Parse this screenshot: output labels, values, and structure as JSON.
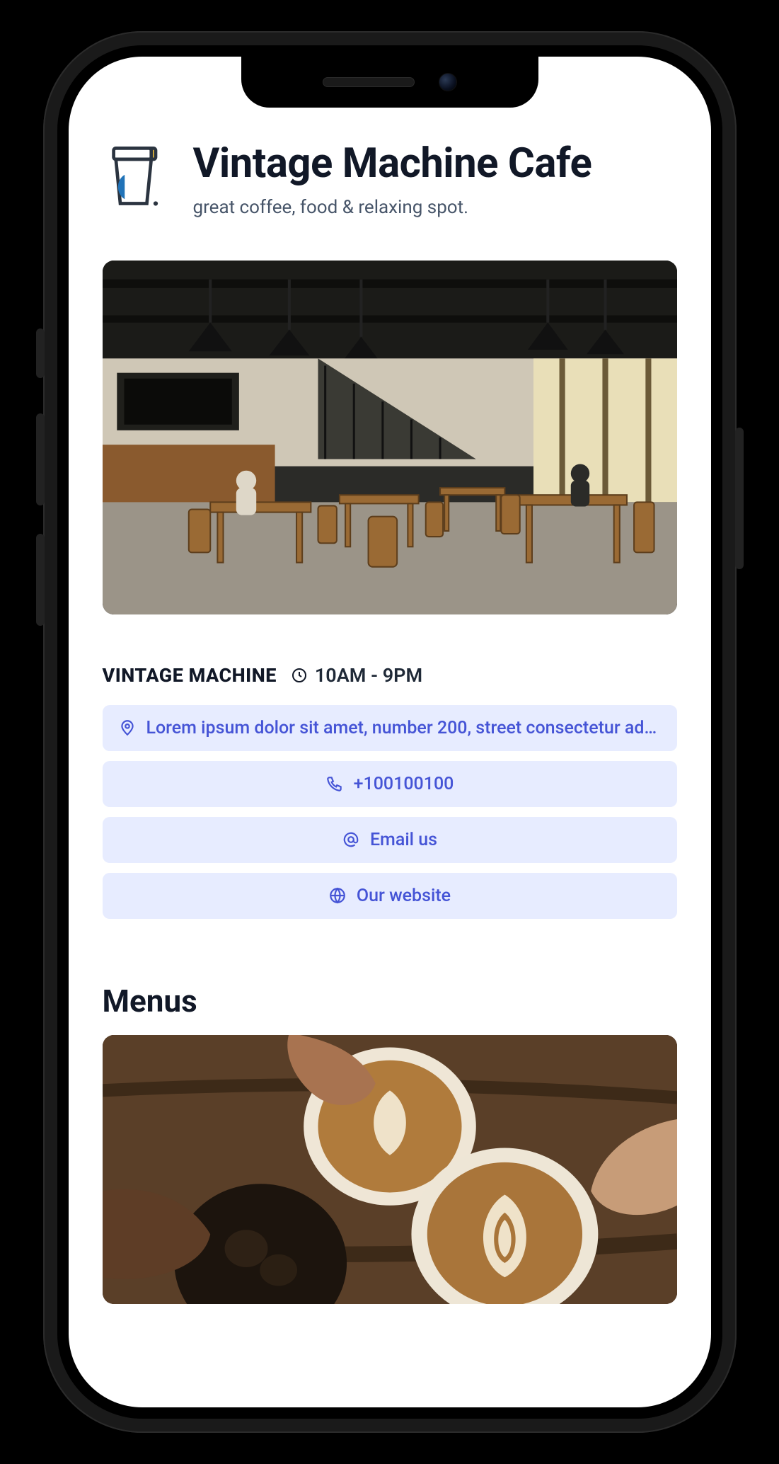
{
  "header": {
    "title": "Vintage Machine Cafe",
    "tagline": "great coffee, food & relaxing spot."
  },
  "info": {
    "brand_label": "VINTAGE MACHINE",
    "hours": "10AM - 9PM"
  },
  "contact": {
    "address": "Lorem ipsum dolor sit amet, number 200, street consectetur adi...",
    "phone": "+100100100",
    "email_label": "Email us",
    "website_label": "Our website"
  },
  "menus": {
    "section_title": "Menus"
  }
}
